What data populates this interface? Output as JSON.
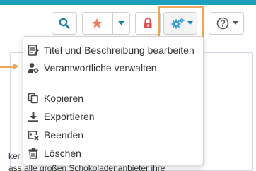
{
  "colors": {
    "accent": "#1b9fbd",
    "highlight": "#f0a65a",
    "search_icon": "#1a7fa5",
    "star_icon": "#f07c5a",
    "lock_icon": "#d9534f",
    "gear_icon": "#3a9fd6"
  },
  "toolbar": {
    "search_icon": "search-icon",
    "bookmark_icon": "star-icon",
    "lock_icon": "lock-icon",
    "tools_icon": "gears-icon",
    "help_icon": "help-icon"
  },
  "menu": {
    "items_top": [
      {
        "label": "Titel und Beschreibung bearbeiten",
        "icon": "edit-document-icon"
      },
      {
        "label": "Verantwortliche verwalten",
        "icon": "user-settings-icon"
      }
    ],
    "items_bottom": [
      {
        "label": "Kopieren",
        "icon": "copy-icon"
      },
      {
        "label": "Exportieren",
        "icon": "download-icon"
      },
      {
        "label": "Beenden",
        "icon": "finish-icon"
      },
      {
        "label": "Löschen",
        "icon": "trash-icon"
      }
    ]
  },
  "background_text": {
    "line1": "ker u",
    "line2": "ass alle großen Schokoladenanbieter ihre"
  }
}
